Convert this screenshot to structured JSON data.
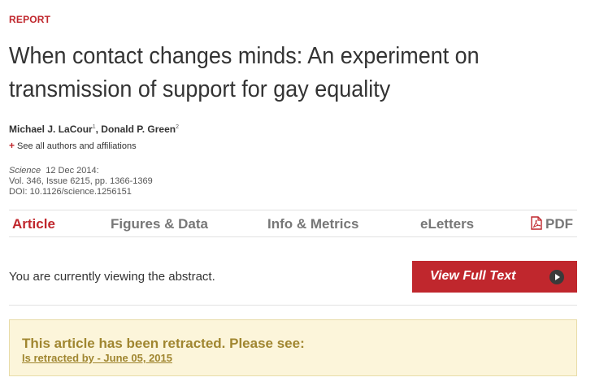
{
  "article": {
    "section_label": "REPORT",
    "title": "When contact changes minds: An experiment on transmission of support for gay equality",
    "authors": [
      {
        "name": "Michael J. LaCour",
        "sup": "1",
        "sep": ", "
      },
      {
        "name": "Donald P. Green",
        "sup": "2",
        "sep": ""
      }
    ],
    "affiliations_toggle": "See all authors and affiliations",
    "citation": {
      "journal": "Science",
      "date": "12 Dec 2014:",
      "volume_line": "Vol. 346, Issue 6215, pp. 1366-1369",
      "doi_line": "DOI: 10.1126/science.1256151"
    }
  },
  "tabs": [
    {
      "label": "Article",
      "active": true
    },
    {
      "label": "Figures & Data",
      "active": false
    },
    {
      "label": "Info & Metrics",
      "active": false
    },
    {
      "label": "eLetters",
      "active": false
    },
    {
      "label": "PDF",
      "active": false,
      "icon": "pdf-icon"
    }
  ],
  "abstract_note": "You are currently viewing the abstract.",
  "full_text_button": {
    "label": "View Full Text",
    "icon": "play-arrow-icon"
  },
  "retraction": {
    "heading": "This article has been retracted. Please see:",
    "link": "Is retracted by - June 05, 2015"
  },
  "colors": {
    "accent": "#c0272d",
    "retraction_bg": "#fcf5da",
    "retraction_text": "#a08630"
  }
}
